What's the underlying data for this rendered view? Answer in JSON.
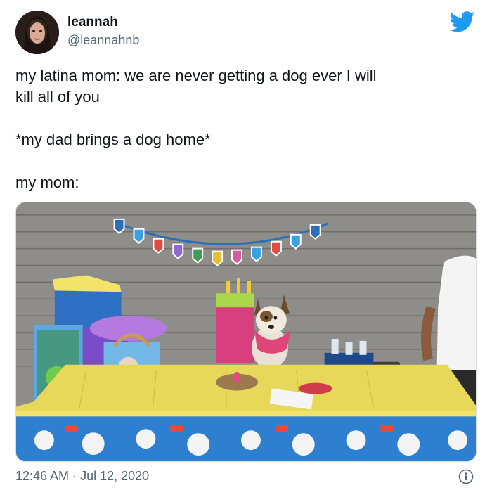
{
  "tweet": {
    "author": {
      "display_name": "leannah",
      "handle": "@leannahnb",
      "avatar_icon": "profile-photo"
    },
    "brand_icon": "twitter-bird-icon",
    "brand_color": "#1d9bf0",
    "lines": [
      "my latina mom: we are never getting a dog ever I will",
      "kill all of you",
      "*my dad brings a dog home*",
      "my mom:"
    ],
    "media": {
      "type": "photo",
      "description_icon": "party-table-dog-photo"
    },
    "timestamp": {
      "time": "12:46 AM",
      "separator": " · ",
      "date": "Jul 12, 2020"
    },
    "info_icon": "info-icon"
  }
}
